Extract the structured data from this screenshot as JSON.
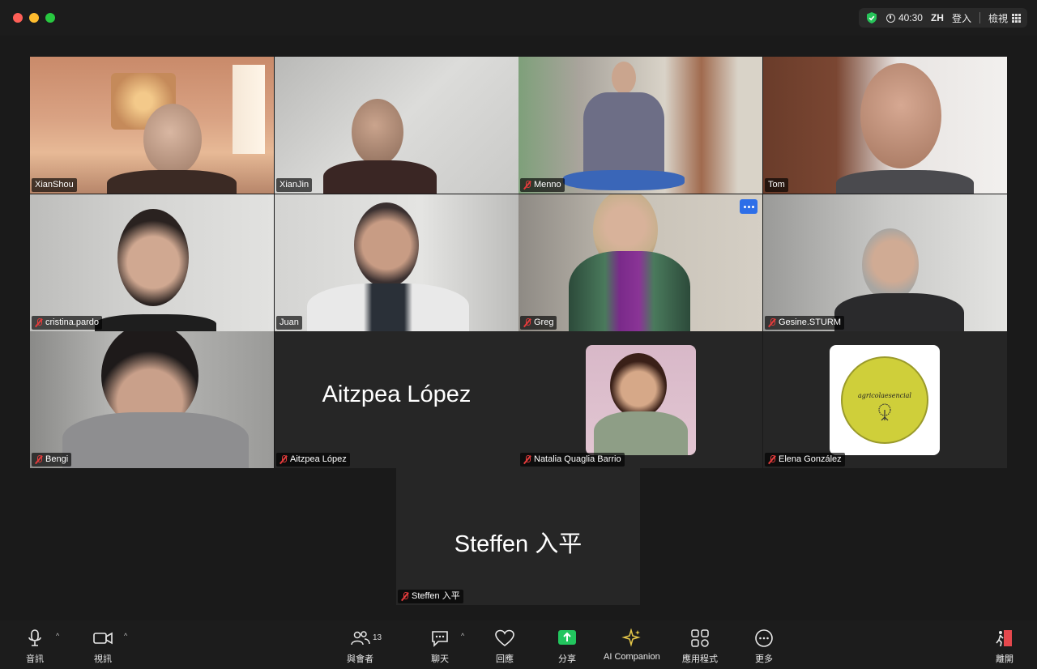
{
  "window": {
    "timer": "40:30",
    "lang": "ZH",
    "signin": "登入",
    "view": "檢視"
  },
  "participants": [
    {
      "name": "XianShou",
      "muted": false
    },
    {
      "name": "XianJin",
      "muted": false
    },
    {
      "name": "Menno",
      "muted": true
    },
    {
      "name": "Tom",
      "muted": false
    },
    {
      "name": "cristina.pardo",
      "muted": true
    },
    {
      "name": "Juan",
      "muted": false
    },
    {
      "name": "Greg",
      "muted": true
    },
    {
      "name": "Gesine.STURM",
      "muted": true
    },
    {
      "name": "Bengi",
      "muted": true
    },
    {
      "name": "Aitzpea López",
      "muted": true,
      "display": "Aitzpea López"
    },
    {
      "name": "Natalia Quaglia Barrio",
      "muted": true
    },
    {
      "name": "Elena González",
      "muted": true,
      "logo_text": "agricolaesencial"
    },
    {
      "name": "Steffen 入平",
      "muted": true,
      "display": "Steffen 入平"
    }
  ],
  "toolbar": {
    "audio": "音訊",
    "video": "視訊",
    "participants": "與會者",
    "participants_count": "13",
    "chat": "聊天",
    "react": "回應",
    "share": "分享",
    "ai": "AI Companion",
    "apps": "應用程式",
    "more": "更多",
    "leave": "離開"
  },
  "colors": {
    "active_speaker": "#5ee05e",
    "share_green": "#22c55e",
    "mute_red": "#e23b3b",
    "leave_red": "#e5484d"
  }
}
